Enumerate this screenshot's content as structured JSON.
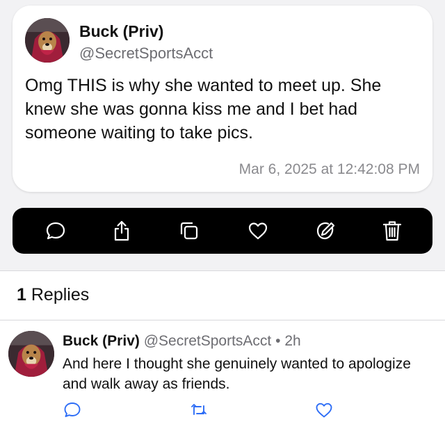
{
  "post": {
    "author_name": "Buck (Priv)",
    "author_handle": "@SecretSportsAcct",
    "body": "Omg THIS is why she wanted to meet up. She knew she was gonna kiss me and I bet had someone waiting to take pics.",
    "timestamp": "Mar 6, 2025 at 12:42:08 PM"
  },
  "toolbar": {
    "icons": [
      "reply-icon",
      "share-icon",
      "copy-icon",
      "like-icon",
      "edit-icon",
      "delete-icon"
    ]
  },
  "replies": {
    "count": "1",
    "label": "Replies",
    "items": [
      {
        "author_name": "Buck (Priv)",
        "author_handle": "@SecretSportsAcct",
        "time": "2h",
        "body": "And here I thought she genuinely wanted to apologize and walk away as friends.",
        "icons": [
          "reply-icon",
          "repost-icon",
          "like-icon"
        ]
      }
    ]
  },
  "colors": {
    "page_bg": "#f2f2f4",
    "card_bg": "#ffffff",
    "toolbar_bg": "#000000",
    "secondary_text": "#6d6d72",
    "icon_blue": "#2d6df6"
  }
}
